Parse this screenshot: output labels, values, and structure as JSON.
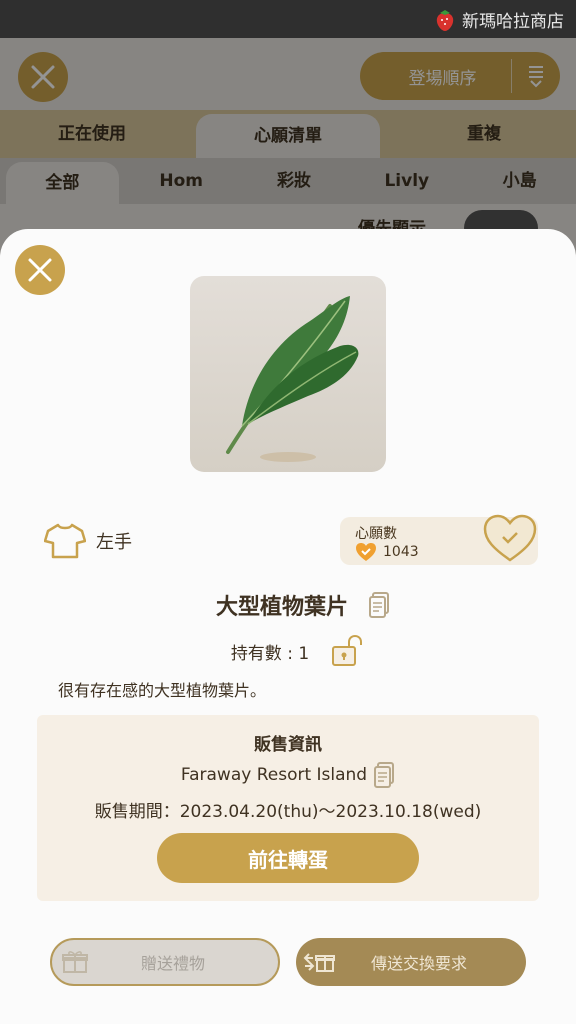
{
  "status_bar": {
    "shop_name": "新瑪哈拉商店"
  },
  "background": {
    "order_button": "登場順序",
    "main_tabs": [
      "正在使用",
      "心願清單",
      "重複"
    ],
    "sub_tabs": [
      "全部",
      "Hom",
      "彩妝",
      "Livly",
      "小島"
    ],
    "priority_toggle_label": "優先顯示"
  },
  "item": {
    "slot": "左手",
    "wishlist": {
      "title": "心願數",
      "count": "1043"
    },
    "name": "大型植物葉片",
    "owned": "持有數 : 1",
    "description": "很有存在感的大型植物葉片。"
  },
  "sale_info": {
    "title": "販售資訊",
    "location": "Faraway Resort Island",
    "period": "販售期間：2023.04.20(thu)～2023.10.18(wed)",
    "go_button": "前往轉蛋"
  },
  "actions": {
    "gift_button": "贈送禮物",
    "trade_button": "傳送交換要求"
  },
  "colors": {
    "accent": "#c8a24d",
    "panel": "#f6efe5",
    "text": "#3f3222"
  }
}
